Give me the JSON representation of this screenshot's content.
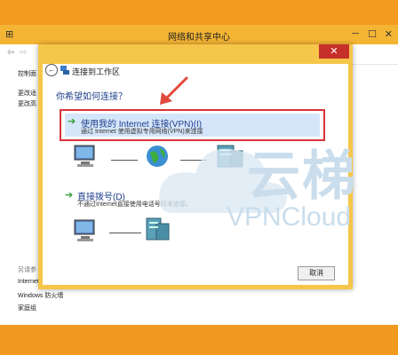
{
  "window": {
    "title": "网络和共享中心",
    "sidebar_items": [
      "控制面",
      "更改适",
      "更改高"
    ],
    "see_also_label": "另请参",
    "see_also_items": [
      "Internet",
      "Windows 防火墙",
      "家庭组"
    ],
    "nav_back": "←"
  },
  "dialog": {
    "title": "连接到工作区",
    "close_glyph": "✕",
    "question": "你希望如何连接？",
    "option_vpn": {
      "title": "使用我的 Internet 连接(VPN)(I)",
      "desc": "通过 Internet 使用虚拟专用网络(VPN)来连接"
    },
    "option_dial": {
      "title": "直接拨号(D)",
      "desc": "不通过Internet直接使用电话号码来连接。"
    },
    "cancel_label": "取消"
  },
  "watermark": {
    "brand_cn": "云梯",
    "brand_en": "VPNCloud"
  },
  "colors": {
    "desktop": "#f39a1f",
    "dialog_frame": "#f6c64a",
    "highlight_border": "#d8343a",
    "link_blue": "#1e3f8c"
  }
}
